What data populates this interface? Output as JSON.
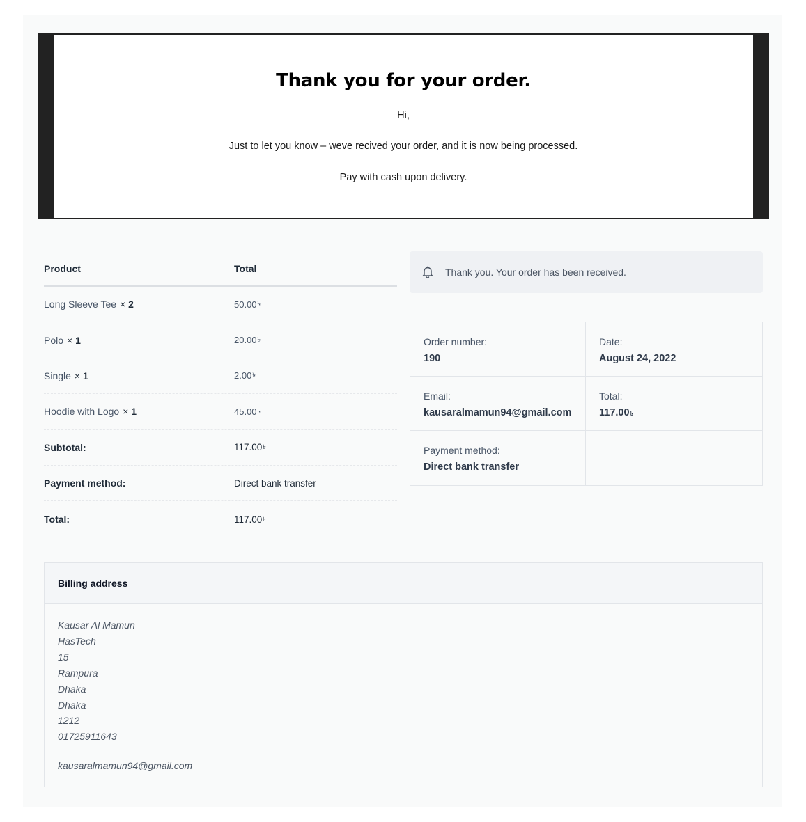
{
  "hero": {
    "title": "Thank you for your order.",
    "greeting": "Hi,",
    "message": "Just to let you know – weve recived your order, and it is now being processed.",
    "payment_note": "Pay with cash upon delivery."
  },
  "order_table": {
    "header": {
      "product": "Product",
      "total": "Total"
    },
    "items": [
      {
        "name": "Long Sleeve Tee",
        "qty_sep": "×",
        "qty": "2",
        "total": "50.00",
        "currency": "৳"
      },
      {
        "name": "Polo",
        "qty_sep": "×",
        "qty": "1",
        "total": "20.00",
        "currency": "৳"
      },
      {
        "name": "Single",
        "qty_sep": "×",
        "qty": "1",
        "total": "2.00",
        "currency": "৳"
      },
      {
        "name": "Hoodie with Logo",
        "qty_sep": "×",
        "qty": "1",
        "total": "45.00",
        "currency": "৳"
      }
    ],
    "subtotal": {
      "label": "Subtotal:",
      "value": "117.00",
      "currency": "৳"
    },
    "payment_method": {
      "label": "Payment method:",
      "value": "Direct bank transfer"
    },
    "total": {
      "label": "Total:",
      "value": "117.00",
      "currency": "৳"
    }
  },
  "notice": {
    "icon": "bell-icon",
    "text": "Thank you. Your order has been received."
  },
  "overview": {
    "order_number": {
      "label": "Order number:",
      "value": "190"
    },
    "date": {
      "label": "Date:",
      "value": "August 24, 2022"
    },
    "email": {
      "label": "Email:",
      "value": "kausaralmamun94@gmail.com"
    },
    "total": {
      "label": "Total:",
      "value": "117.00",
      "currency": "৳"
    },
    "payment_method": {
      "label": "Payment method:",
      "value": "Direct bank transfer"
    }
  },
  "billing": {
    "title": "Billing address",
    "lines": [
      "Kausar Al Mamun",
      "HasTech",
      "15",
      "Rampura",
      "Dhaka",
      "Dhaka",
      "1212",
      "01725911643"
    ],
    "email": "kausaralmamun94@gmail.com"
  }
}
